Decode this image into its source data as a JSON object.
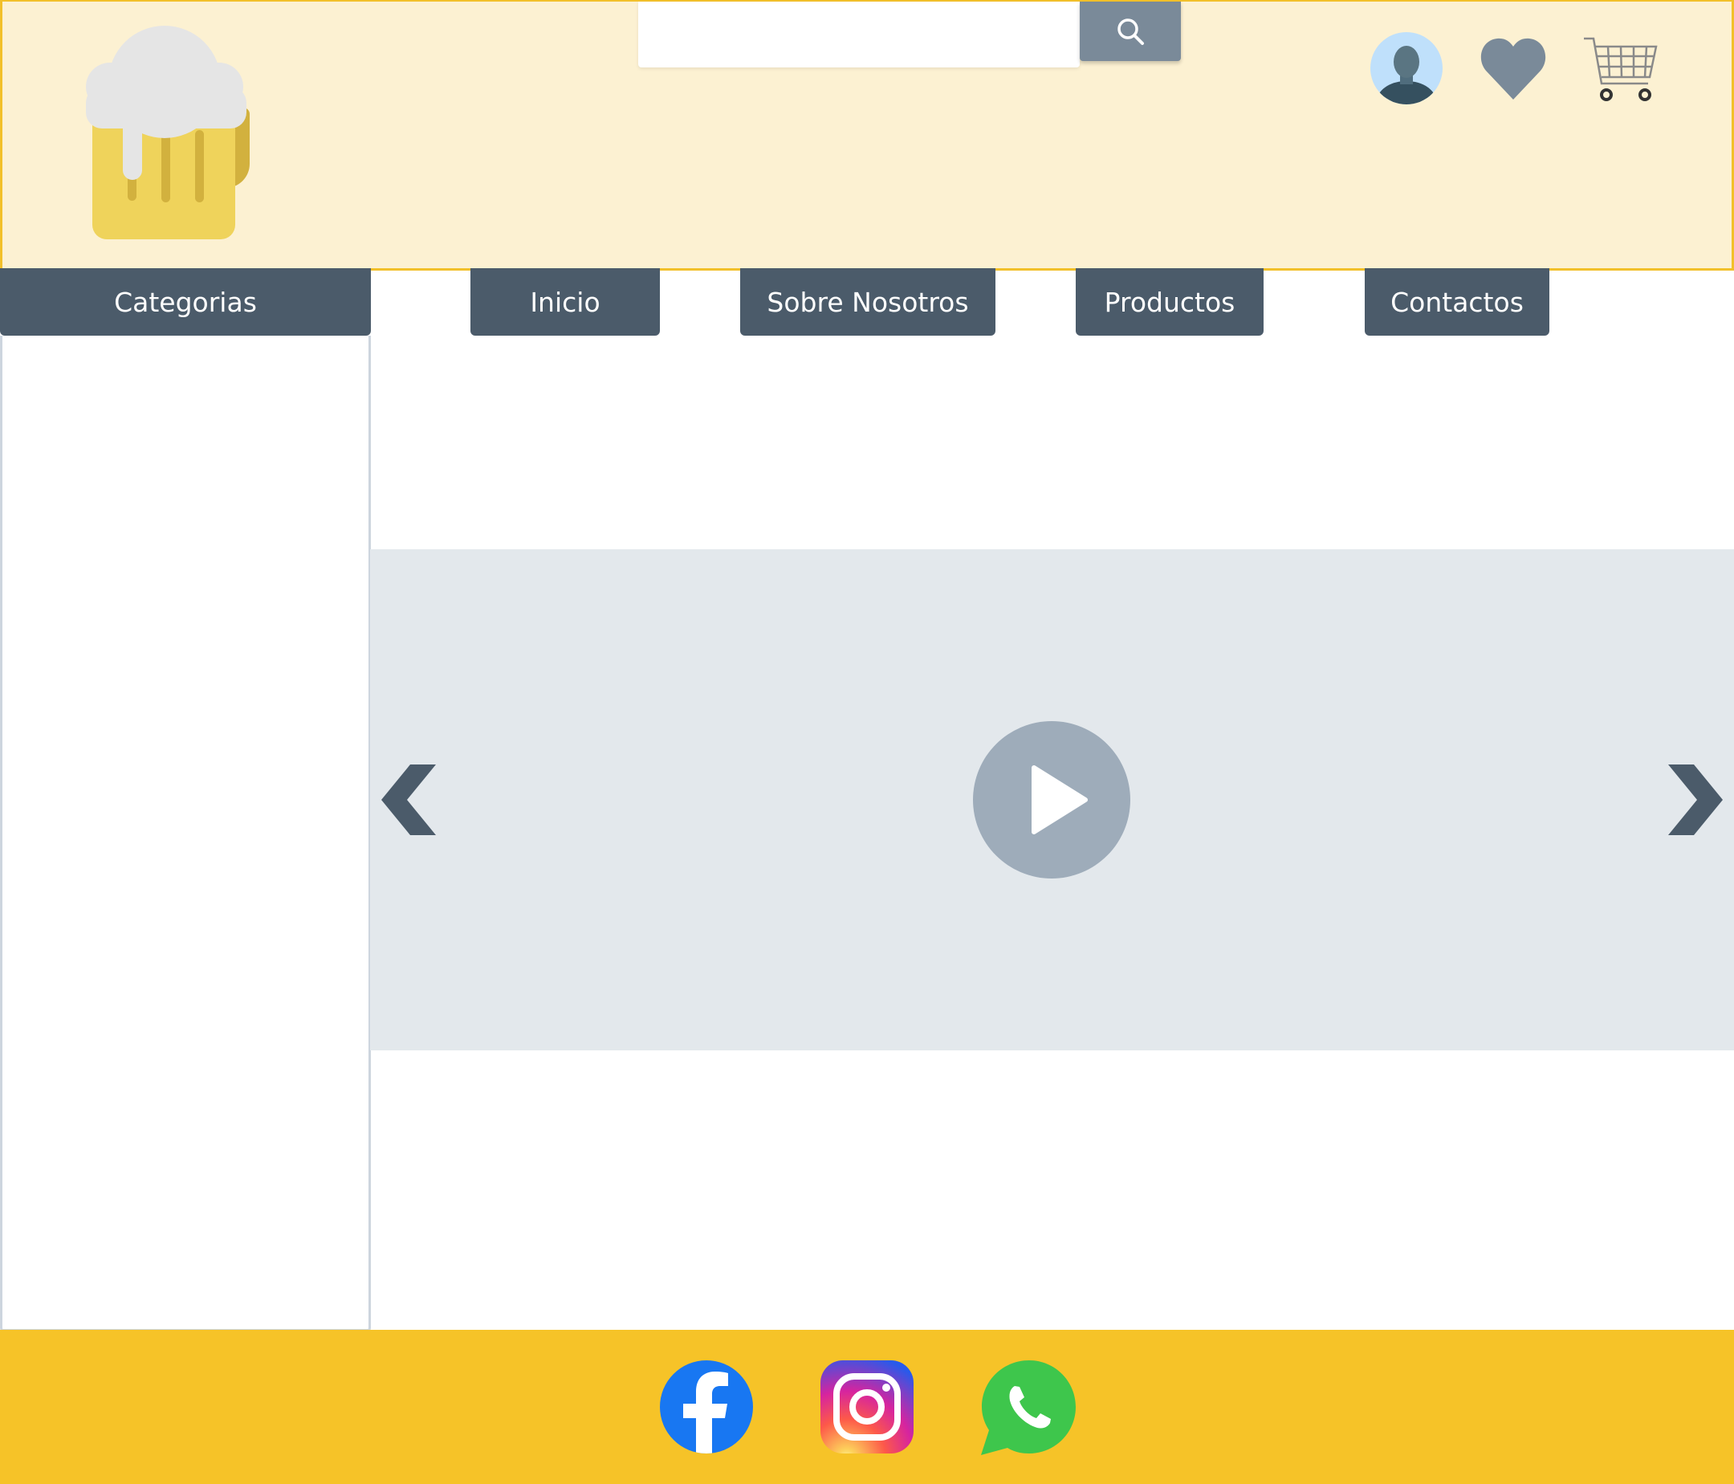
{
  "header": {
    "logo": {
      "icon": "beer-mug-icon"
    },
    "search": {
      "placeholder": "",
      "value": "",
      "button_icon": "search-icon"
    },
    "actions": [
      {
        "name": "user-avatar",
        "icon": "user-avatar-icon"
      },
      {
        "name": "favorites",
        "icon": "heart-icon"
      },
      {
        "name": "cart",
        "icon": "shopping-cart-icon"
      }
    ]
  },
  "nav": {
    "categories_label": "Categorias",
    "items": [
      {
        "label": "Inicio"
      },
      {
        "label": "Sobre Nosotros"
      },
      {
        "label": "Productos"
      },
      {
        "label": "Contactos"
      }
    ]
  },
  "carousel": {
    "prev_icon": "chevron-left-icon",
    "next_icon": "chevron-right-icon",
    "play_icon": "play-icon"
  },
  "footer": {
    "social": [
      {
        "name": "facebook",
        "icon": "facebook-icon"
      },
      {
        "name": "instagram",
        "icon": "instagram-icon"
      },
      {
        "name": "whatsapp",
        "icon": "whatsapp-icon"
      }
    ]
  },
  "colors": {
    "header_bg": "#fcf1d2",
    "header_border": "#f2c02a",
    "nav_bg": "#4b5b6a",
    "carousel_bg": "#e3e8ec",
    "footer_bg": "#f6c328",
    "search_button_bg": "#7a8a99"
  }
}
